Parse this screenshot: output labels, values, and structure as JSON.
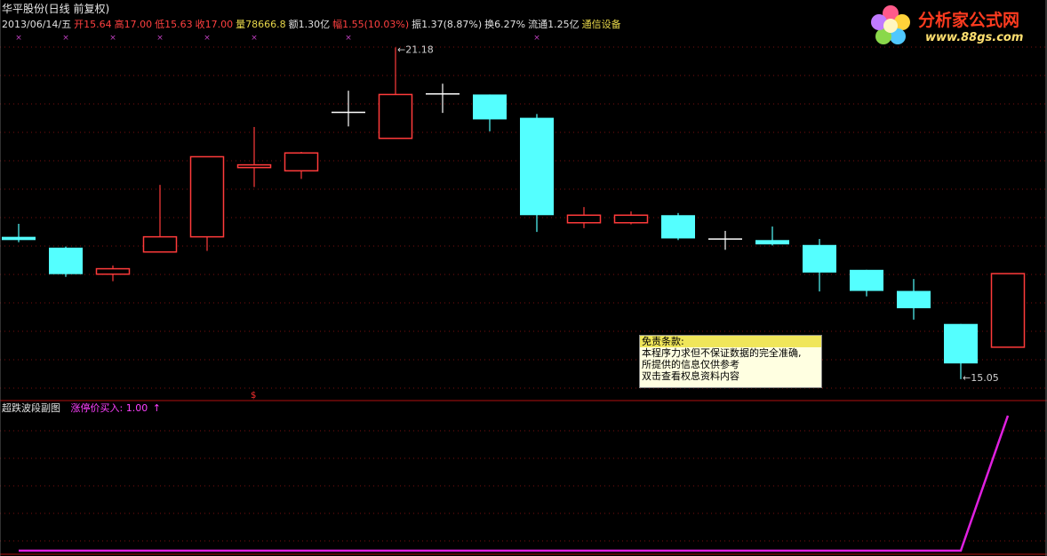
{
  "header": {
    "stock_title": "华平股份(日线 前复权)",
    "quote": [
      {
        "label": "2013/06/14/五",
        "color": "#e0e0e0"
      },
      {
        "label": "开15.64",
        "color": "#ff4040"
      },
      {
        "label": "高17.00",
        "color": "#ff4040"
      },
      {
        "label": "低15.63",
        "color": "#ff4040"
      },
      {
        "label": "收17.00",
        "color": "#ff4040"
      },
      {
        "label": "量78666.8",
        "color": "#e8d84a"
      },
      {
        "label": "额1.30亿",
        "color": "#e0e0e0"
      },
      {
        "label": "幅1.55(10.03%)",
        "color": "#ff4040"
      },
      {
        "label": "振1.37(8.87%)",
        "color": "#e0e0e0"
      },
      {
        "label": "换6.27%",
        "color": "#e0e0e0"
      },
      {
        "label": "流通1.25亿",
        "color": "#e0e0e0"
      },
      {
        "label": "通信设备",
        "color": "#e8d84a"
      }
    ]
  },
  "logo": {
    "text": "分析家公式网",
    "url": "www.88gs.com"
  },
  "disclaimer": {
    "title": "免责条款:",
    "lines": [
      "本程序力求但不保证数据的完全准确,",
      "所提供的信息仅供参考",
      "双击查看权息资料内容"
    ]
  },
  "sub_panel": {
    "title": "超跌波段副图",
    "indicator_label": "涨停价买入: 1.00",
    "indicator_color": "#ff40ff",
    "marker": "$"
  },
  "colors": {
    "up": "#ff3b3b",
    "down": "#54ffff",
    "doji": "#ffffff",
    "grid": "#7a1010",
    "divider": "#b01010",
    "line": "#e020e0",
    "marker": "#c040c0"
  },
  "chart_data": [
    {
      "type": "candlestick",
      "y_axis": [
        14.9,
        21.4
      ],
      "annotations": [
        {
          "text": "21.18",
          "kind": "high",
          "index": 8
        },
        {
          "text": "15.05",
          "kind": "low",
          "index": 20
        }
      ],
      "markers_x": [
        0,
        1,
        2,
        3,
        4,
        5,
        7,
        11
      ],
      "candles": [
        {
          "o": 17.68,
          "h": 17.92,
          "l": 17.58,
          "c": 17.62,
          "t": "down"
        },
        {
          "o": 17.48,
          "h": 17.5,
          "l": 16.94,
          "c": 16.99,
          "t": "down"
        },
        {
          "o": 16.99,
          "h": 17.15,
          "l": 16.86,
          "c": 17.09,
          "t": "up"
        },
        {
          "o": 17.4,
          "h": 18.64,
          "l": 17.4,
          "c": 17.68,
          "t": "up"
        },
        {
          "o": 17.68,
          "h": 18.95,
          "l": 17.42,
          "c": 19.16,
          "t": "up"
        },
        {
          "o": 18.96,
          "h": 19.71,
          "l": 18.6,
          "c": 19.01,
          "t": "up"
        },
        {
          "o": 18.9,
          "h": 19.25,
          "l": 18.75,
          "c": 19.23,
          "t": "up"
        },
        {
          "o": 19.98,
          "h": 20.38,
          "l": 19.72,
          "c": 19.98,
          "t": "doji"
        },
        {
          "o": 19.5,
          "h": 21.18,
          "l": 19.5,
          "c": 20.31,
          "t": "up"
        },
        {
          "o": 20.32,
          "h": 20.51,
          "l": 19.97,
          "c": 20.32,
          "t": "doji"
        },
        {
          "o": 20.31,
          "h": 20.31,
          "l": 19.63,
          "c": 19.85,
          "t": "down"
        },
        {
          "o": 19.88,
          "h": 19.95,
          "l": 17.77,
          "c": 18.08,
          "t": "down"
        },
        {
          "o": 18.08,
          "h": 18.23,
          "l": 17.84,
          "c": 17.94,
          "t": "up"
        },
        {
          "o": 18.08,
          "h": 18.15,
          "l": 17.91,
          "c": 17.94,
          "t": "up"
        },
        {
          "o": 18.08,
          "h": 18.12,
          "l": 17.62,
          "c": 17.65,
          "t": "down"
        },
        {
          "o": 17.64,
          "h": 17.79,
          "l": 17.44,
          "c": 17.64,
          "t": "doji"
        },
        {
          "o": 17.62,
          "h": 17.87,
          "l": 17.52,
          "c": 17.54,
          "t": "down"
        },
        {
          "o": 17.53,
          "h": 17.64,
          "l": 16.67,
          "c": 17.02,
          "t": "down"
        },
        {
          "o": 17.07,
          "h": 17.07,
          "l": 16.58,
          "c": 16.68,
          "t": "down"
        },
        {
          "o": 16.68,
          "h": 16.9,
          "l": 16.15,
          "c": 16.36,
          "t": "down"
        },
        {
          "o": 16.07,
          "h": 16.07,
          "l": 15.05,
          "c": 15.34,
          "t": "down"
        },
        {
          "o": 15.64,
          "h": 17.0,
          "l": 15.63,
          "c": 17.0,
          "t": "up"
        }
      ]
    },
    {
      "type": "line",
      "series": [
        {
          "name": "涨停价买入",
          "values": [
            0,
            0,
            0,
            0,
            0,
            0,
            0,
            0,
            0,
            0,
            0,
            0,
            0,
            0,
            0,
            0,
            0,
            0,
            0,
            0,
            0,
            1
          ]
        }
      ],
      "y_axis": [
        0,
        1
      ]
    }
  ]
}
